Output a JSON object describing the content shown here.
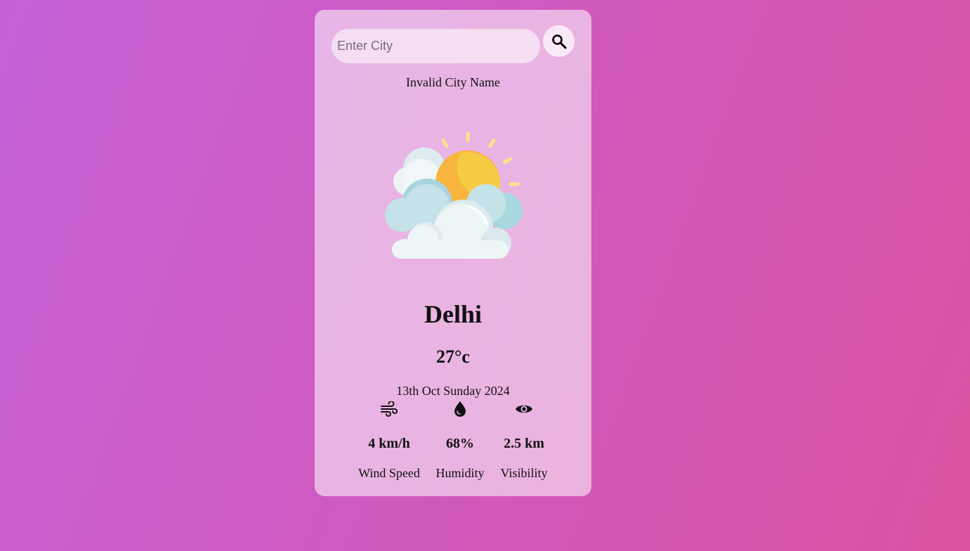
{
  "search": {
    "placeholder": "Enter City"
  },
  "error_message": "Invalid City Name",
  "weather": {
    "icon": "partly-cloudy-sun",
    "city": "Delhi",
    "temperature": "27°c",
    "date": "13th Oct Sunday 2024"
  },
  "stats": {
    "wind": {
      "icon": "wind-icon",
      "value": "4 km/h",
      "label": "Wind Speed"
    },
    "humidity": {
      "icon": "droplet-icon",
      "value": "68%",
      "label": "Humidity"
    },
    "visibility": {
      "icon": "eye-icon",
      "value": "2.5 km",
      "label": "Visibility"
    }
  }
}
